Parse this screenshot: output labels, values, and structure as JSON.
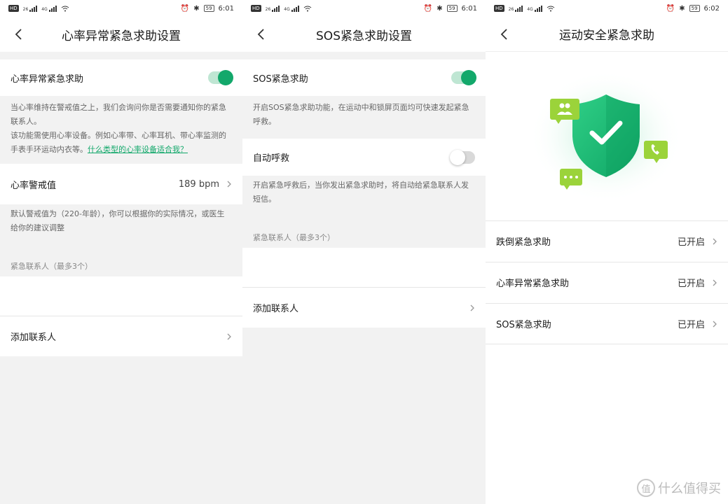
{
  "panels": [
    {
      "status": {
        "time": "6:01",
        "battery": "59"
      },
      "title": "心率异常紧急求助设置",
      "toggle_label": "心率异常紧急求助",
      "toggle_on": true,
      "desc1": "当心率维持在警戒值之上，我们会询问你是否需要通知你的紧急联系人。",
      "desc2": "该功能需使用心率设备。例如心率带、心率耳机、带心率监测的手表手环运动内衣等。",
      "desc_link": "什么类型的心率设备适合我？",
      "threshold_label": "心率警戒值",
      "threshold_value": "189 bpm",
      "threshold_desc": "默认警戒值为（220-年龄），你可以根据你的实际情况，或医生给你的建议调整",
      "contacts_header": "紧急联系人（最多3个）",
      "add_contact": "添加联系人"
    },
    {
      "status": {
        "time": "6:01",
        "battery": "59"
      },
      "title": "SOS紧急求助设置",
      "toggle_label": "SOS紧急求助",
      "toggle_on": true,
      "desc": "开启SOS紧急求助功能，在运动中和锁屏页面均可快速发起紧急呼救。",
      "auto_label": "自动呼救",
      "auto_on": false,
      "auto_desc": "开启紧急呼救后，当你发出紧急求助时，将自动给紧急联系人发短信。",
      "contacts_header": "紧急联系人（最多3个）",
      "add_contact": "添加联系人"
    },
    {
      "status": {
        "time": "6:02",
        "battery": "59"
      },
      "title": "运动安全紧急求助",
      "items": [
        {
          "label": "跌倒紧急求助",
          "value": "已开启"
        },
        {
          "label": "心率异常紧急求助",
          "value": "已开启"
        },
        {
          "label": "SOS紧急求助",
          "value": "已开启"
        }
      ]
    }
  ],
  "watermark": "什么值得买",
  "watermark_icon": "值",
  "colors": {
    "accent": "#13a86b",
    "badge": "#9bd33a"
  }
}
